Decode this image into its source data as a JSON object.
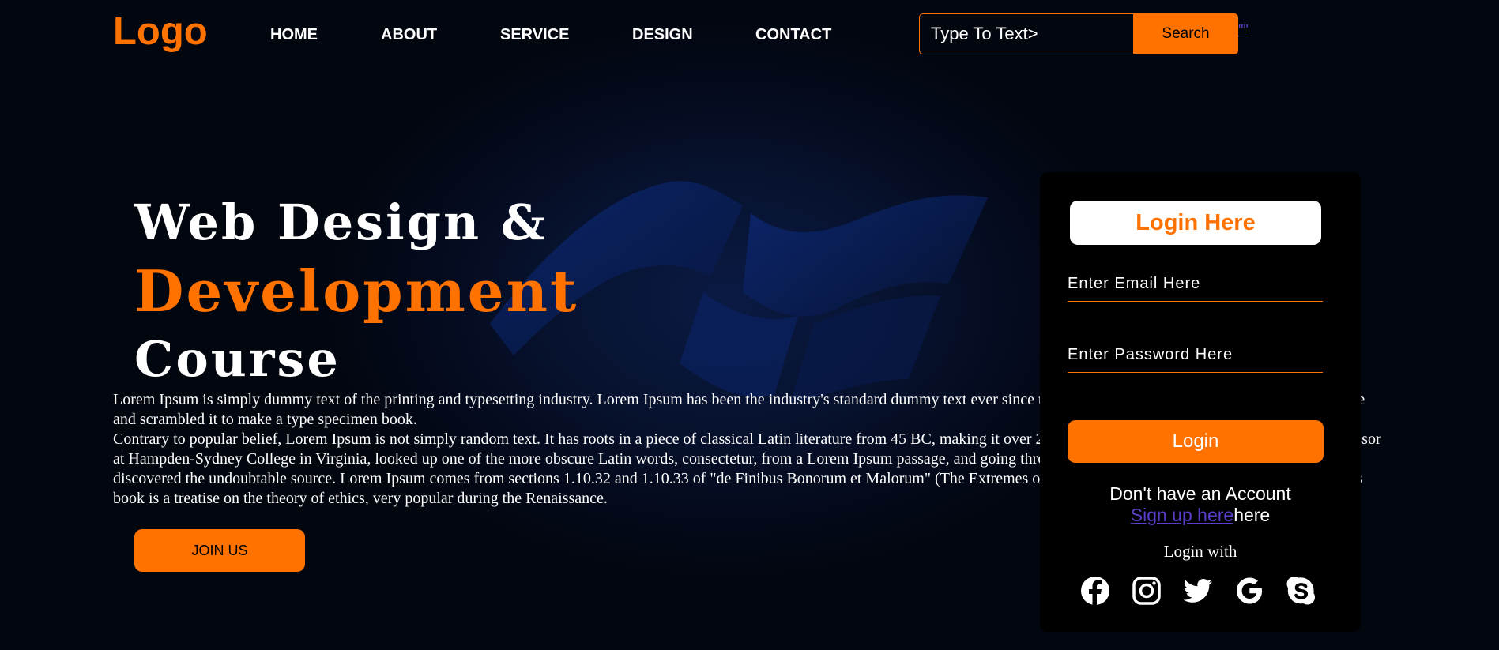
{
  "header": {
    "logo": "Logo",
    "nav": [
      {
        "label": "HOME"
      },
      {
        "label": "ABOUT"
      },
      {
        "label": "SERVICE"
      },
      {
        "label": "DESIGN"
      },
      {
        "label": "CONTACT"
      }
    ],
    "search": {
      "placeholder": "Type To Text>",
      "button": "Search"
    },
    "stray_link": "\"\""
  },
  "hero": {
    "title_line1": "Web Design &",
    "title_line2": "Development",
    "title_line3": "Course",
    "paragraph1": "Lorem Ipsum is simply dummy text of the printing and typesetting industry. Lorem Ipsum has been the industry's standard dummy text ever since the 1500s, an unknown printer took a galley of type and scrambled it to make a type specimen book.",
    "paragraph2": "Contrary to popular belief, Lorem Ipsum is not simply random text. It has roots in a piece of classical Latin literature from 45 BC, making it over 2000 years old. Richard McClintock, a Latin professor at Hampden-Sydney College in Virginia, looked up one of the more obscure Latin words, consectetur, from a Lorem Ipsum passage, and going through the cites of the word in classical literature, discovered the undoubtable source. Lorem Ipsum comes from sections 1.10.32 and 1.10.33 of \"de Finibus Bonorum et Malorum\" (The Extremes of Good and Evil) by Cicero, written in 45 BC. This book is a treatise on the theory of ethics, very popular during the Renaissance.",
    "join_button": "JOIN US"
  },
  "login": {
    "title": "Login Here",
    "email_placeholder": "Enter Email Here",
    "password_placeholder": "Enter Password Here",
    "button": "Login",
    "no_account": "Don't have an Account",
    "signup_link": "Sign up here",
    "signup_suffix": "here",
    "login_with": "Login with",
    "socials": [
      "facebook-icon",
      "instagram-icon",
      "twitter-icon",
      "google-icon",
      "skype-icon"
    ]
  },
  "colors": {
    "accent": "#ff7200",
    "background": "#040a1c",
    "card": "#000000",
    "link": "#5b3dc9"
  }
}
